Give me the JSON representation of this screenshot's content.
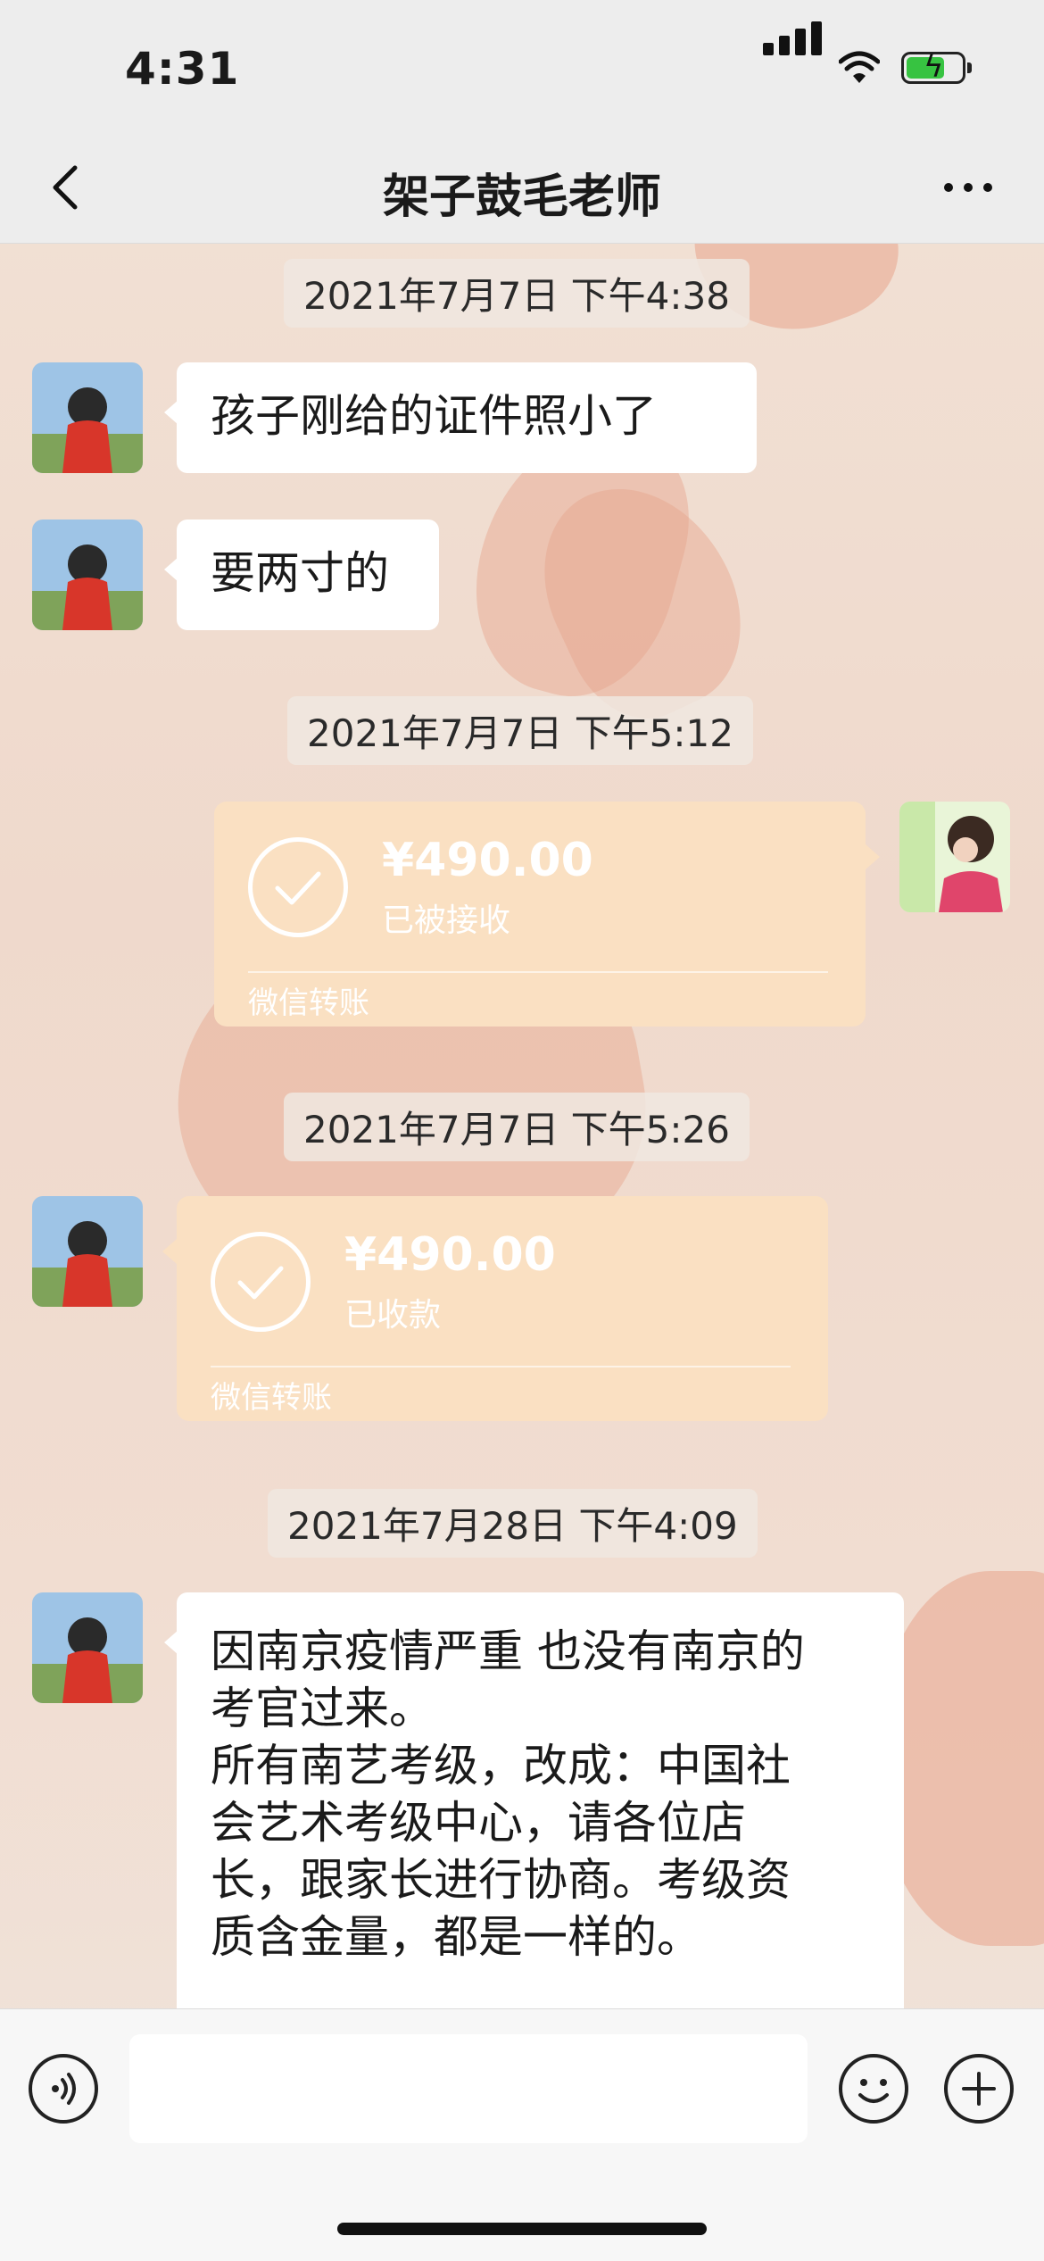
{
  "status_bar": {
    "time": "4:31"
  },
  "chat": {
    "title": "架子鼓毛老师",
    "messages": [
      {
        "type": "timestamp",
        "text": "2021年7月7日 下午4:38"
      },
      {
        "type": "text",
        "side": "left",
        "text": "孩子刚给的证件照小了"
      },
      {
        "type": "text",
        "side": "left",
        "text": "要两寸的"
      },
      {
        "type": "timestamp",
        "text": "2021年7月7日 下午5:12"
      },
      {
        "type": "transfer",
        "side": "right",
        "amount": "¥490.00",
        "status": "已被接收",
        "label": "微信转账"
      },
      {
        "type": "timestamp",
        "text": "2021年7月7日 下午5:26"
      },
      {
        "type": "transfer",
        "side": "left",
        "amount": "¥490.00",
        "status": "已收款",
        "label": "微信转账"
      },
      {
        "type": "timestamp",
        "text": "2021年7月28日 下午4:09"
      },
      {
        "type": "text",
        "side": "left",
        "lines": [
          "因南京疫情严重  也没有南京的",
          "考官过来。",
          "所有南艺考级，改成：中国社",
          "会艺术考级中心，请各位店",
          "长，跟家长进行协商。考级资",
          "质含金量，都是一样的。"
        ]
      }
    ]
  },
  "icons": {
    "back": "chevron-left-icon",
    "more": "more-dots-icon",
    "voice": "voice-icon",
    "emoji": "emoji-icon",
    "plus": "plus-icon"
  },
  "colors": {
    "transfer_bubble": "#fae0c2",
    "battery": "#37c341",
    "bubble": "#ffffff"
  }
}
